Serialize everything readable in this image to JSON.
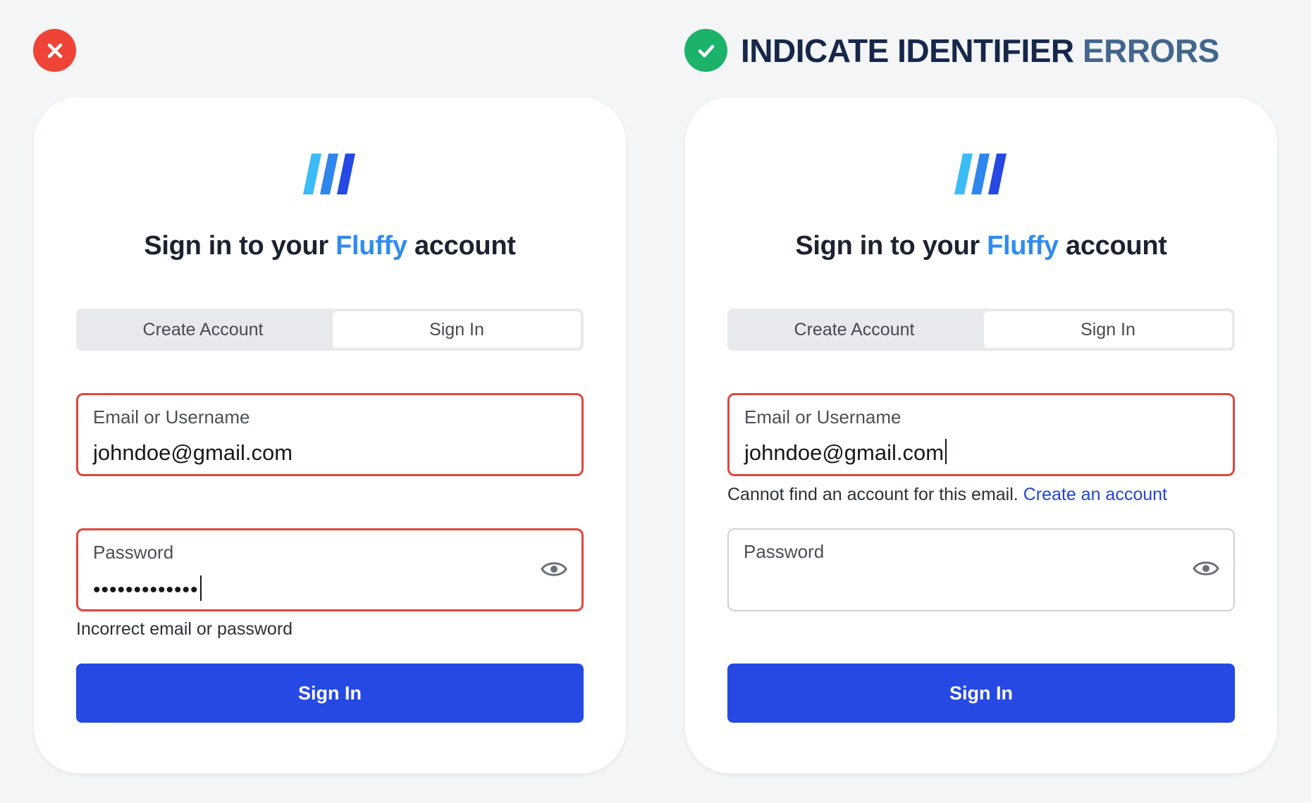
{
  "header": {
    "heading_part1": "INDICATE IDENTIFIER",
    "heading_part2": "ERRORS",
    "bad_icon": "x-icon",
    "good_icon": "check-icon",
    "bad_color": "#ee4336",
    "good_color": "#1bb36a"
  },
  "colors": {
    "brand": "#2f8cf0",
    "button": "#2649e3",
    "error_border": "#e1463c",
    "link": "#2244d9"
  },
  "left_card": {
    "title_before": "Sign in to your ",
    "title_brand": "Fluffy",
    "title_after": " account",
    "tab_create": "Create Account",
    "tab_signin": "Sign In",
    "email_label": "Email or Username",
    "email_value": "johndoe@gmail.com",
    "password_label": "Password",
    "password_value": "•••••••••••••",
    "error_message": "Incorrect email or password",
    "submit_label": "Sign In"
  },
  "right_card": {
    "title_before": "Sign in to your ",
    "title_brand": "Fluffy",
    "title_after": " account",
    "tab_create": "Create Account",
    "tab_signin": "Sign In",
    "email_label": "Email or Username",
    "email_value": "johndoe@gmail.com",
    "error_message": "Cannot find an account for this email.",
    "error_link": "Create an account",
    "password_label": "Password",
    "submit_label": "Sign In"
  }
}
